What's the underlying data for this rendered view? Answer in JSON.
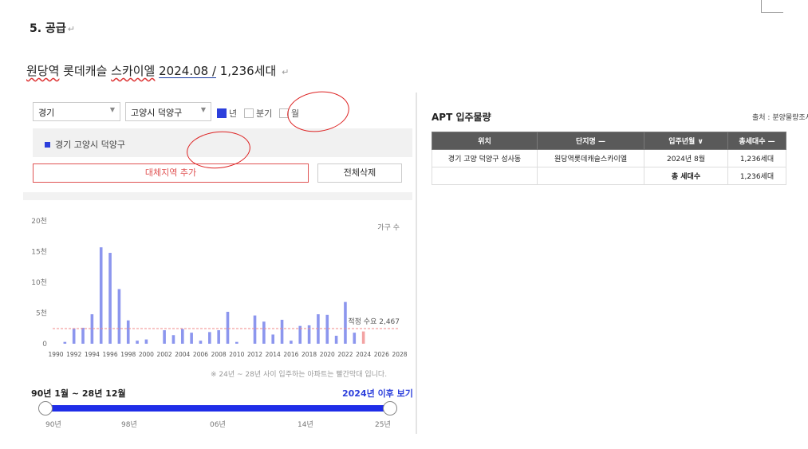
{
  "doc": {
    "heading": "5.  공급",
    "return_mark": "↵",
    "subline": {
      "part1": "원당역",
      "part2": " 롯데캐슬 ",
      "part3": "스카이엘",
      "part4": " ",
      "part5": "2024.08 /",
      "part6": " 1,236세대 "
    }
  },
  "filters": {
    "region1": "경기",
    "region2": "고양시 덕양구",
    "opt_year": "년",
    "opt_quarter": "분기",
    "opt_month": "월"
  },
  "region_list": [
    "경기 고양시 덕양구"
  ],
  "buttons": {
    "add": "대체지역 추가",
    "clear": "전체삭제"
  },
  "chart_data": {
    "type": "bar",
    "legend_label": "가구 수",
    "yticks": [
      "20천",
      "15천",
      "10천",
      "5천",
      "0"
    ],
    "ylim": [
      0,
      20000
    ],
    "x": [
      1990,
      1991,
      1992,
      1993,
      1994,
      1995,
      1996,
      1997,
      1998,
      1999,
      2000,
      2001,
      2002,
      2003,
      2004,
      2005,
      2006,
      2007,
      2008,
      2009,
      2010,
      2011,
      2012,
      2013,
      2014,
      2015,
      2016,
      2017,
      2018,
      2019,
      2020,
      2021,
      2022,
      2023,
      2024,
      2025,
      2026,
      2027,
      2028
    ],
    "values": [
      0,
      300,
      2500,
      2600,
      4800,
      15700,
      14800,
      8900,
      3800,
      500,
      700,
      0,
      2200,
      1400,
      2400,
      1800,
      500,
      1900,
      2200,
      5200,
      300,
      0,
      4600,
      3600,
      1500,
      3900,
      500,
      2900,
      3000,
      4800,
      4700,
      1300,
      6800,
      1800,
      2000,
      0,
      0,
      0,
      0
    ],
    "xtick_labels": [
      "1990",
      "1992",
      "1994",
      "1996",
      "1998",
      "2000",
      "2002",
      "2004",
      "2006",
      "2008",
      "2010",
      "2012",
      "2014",
      "2016",
      "2018",
      "2020",
      "2022",
      "2024",
      "2026",
      "2028"
    ],
    "reference_line": {
      "label": "적정 수요 2,467",
      "value": 2467
    },
    "highlight_from": 2024,
    "bar_color": "#8c96ee",
    "highlight_color": "#f3a3a3"
  },
  "chart_note": "※ 24년 ~ 28년 사이 입주하는 아파트는 빨간막대 입니다.",
  "range": {
    "text": "90년 1월 ~ 28년 12월",
    "link": "2024년 이후 보기",
    "ticks": [
      "90년",
      "98년",
      "06년",
      "14년",
      "25년"
    ]
  },
  "apt": {
    "title": "APT 입주물량",
    "source": "출처 : 분양물량조사",
    "headers": [
      "위치",
      "단지명 —",
      "입주년월 ∨",
      "총세대수 —"
    ],
    "rows": [
      [
        "경기 고양 덕양구 성사동",
        "원당역롯데캐슬스카이엘",
        "2024년 8월",
        "1,236세대"
      ],
      [
        "",
        "",
        "총 세대수",
        "1,236세대"
      ]
    ]
  }
}
